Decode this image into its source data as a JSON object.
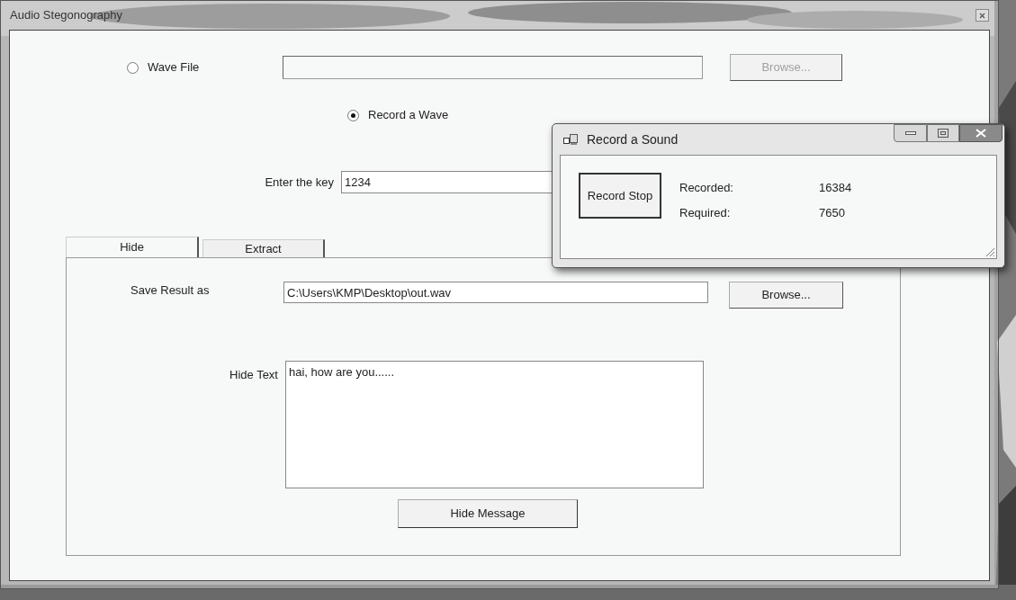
{
  "window": {
    "title": "Audio Stegonography"
  },
  "source_options": [
    {
      "label": "Wave File",
      "selected": false
    },
    {
      "label": "Record a Wave",
      "selected": true
    }
  ],
  "wave_file": {
    "browse_button": {
      "label": "Browse...",
      "disabled": true
    }
  },
  "key": {
    "label": "Enter the key",
    "value": "1234"
  },
  "tabs": [
    {
      "label": "Hide",
      "selected": true
    },
    {
      "label": "Extract",
      "selected": false
    }
  ],
  "hide_tab": {
    "save_label": "Save Result as",
    "save_path": "C:\\Users\\KMP\\Desktop\\out.wav",
    "browse_button": {
      "label": "Browse...",
      "disabled": false
    },
    "text_label": "Hide Text",
    "text": "hai, how are you......",
    "action_button": "Hide Message"
  },
  "record_dialog": {
    "title": "Record a Sound",
    "button_label": "Record Stop",
    "stats": [
      {
        "label": "Recorded:",
        "value": "16384"
      },
      {
        "label": "Required:",
        "value": "7650"
      }
    ]
  }
}
